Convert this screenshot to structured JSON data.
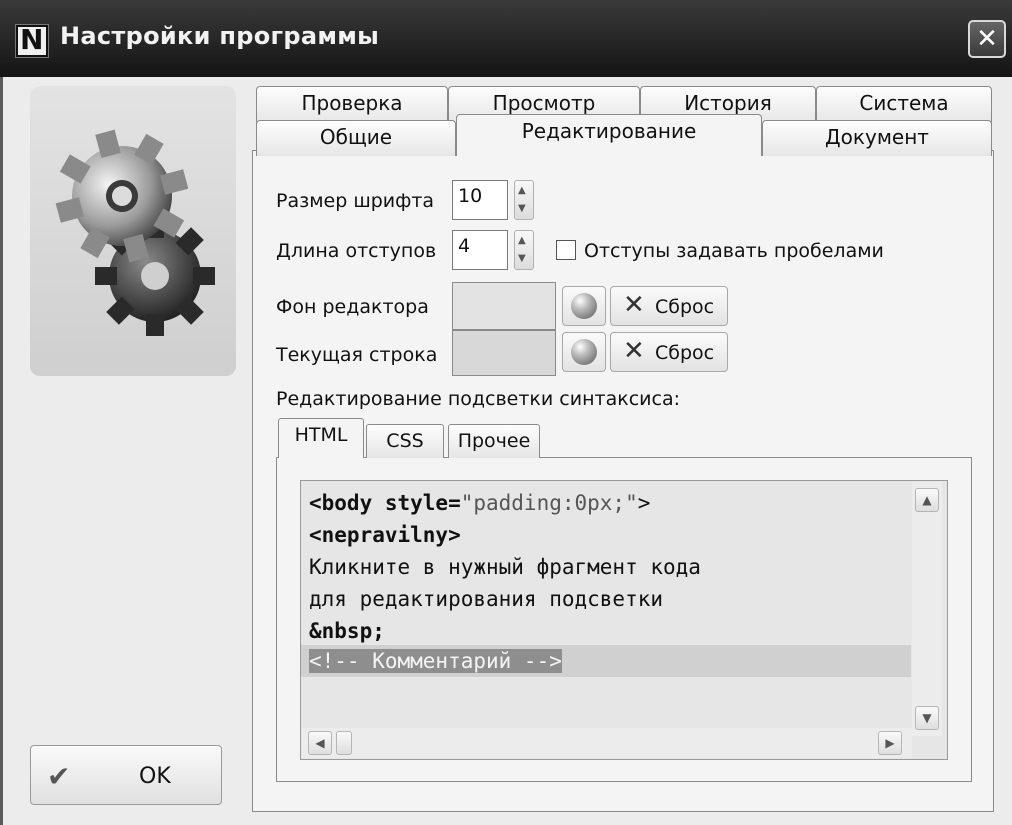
{
  "window": {
    "title": "Настройки программы",
    "close_glyph": "✕",
    "logo_icon": "gears-icon"
  },
  "tabs": {
    "row1": [
      "Проверка",
      "Просмотр",
      "История",
      "Система"
    ],
    "row2": [
      "Общие",
      "Редактирование",
      "Документ"
    ],
    "active": "Редактирование"
  },
  "editing": {
    "font_size_label": "Размер шрифта",
    "font_size_value": "10",
    "indent_label": "Длина отступов",
    "indent_value": "4",
    "indent_spaces_label": "Отступы задавать пробелами",
    "indent_spaces_checked": false,
    "editor_bg_label": "Фон редактора",
    "current_line_label": "Текущая строка",
    "reset_label": "Сброс",
    "syntax_label": "Редактирование подсветки синтаксиса:"
  },
  "syntax_tabs": [
    "HTML",
    "CSS",
    "Прочее"
  ],
  "code": {
    "line1_tag": "<body style=",
    "line1_str": "\"padding:0px;\"",
    "line1_end": ">",
    "line2": "<nepravilny>",
    "line3": "Кликните в нужный фрагмент кода",
    "line4": "для редактирования подсветки",
    "line5": "&nbsp;",
    "line6": "<!-- Комментарий -->"
  },
  "buttons": {
    "ok_label": "OK"
  },
  "colors": {
    "titlebar": "#1e1e1e",
    "comment_highlight": "#9a9a9a",
    "current_line": "#d0d0d0"
  }
}
